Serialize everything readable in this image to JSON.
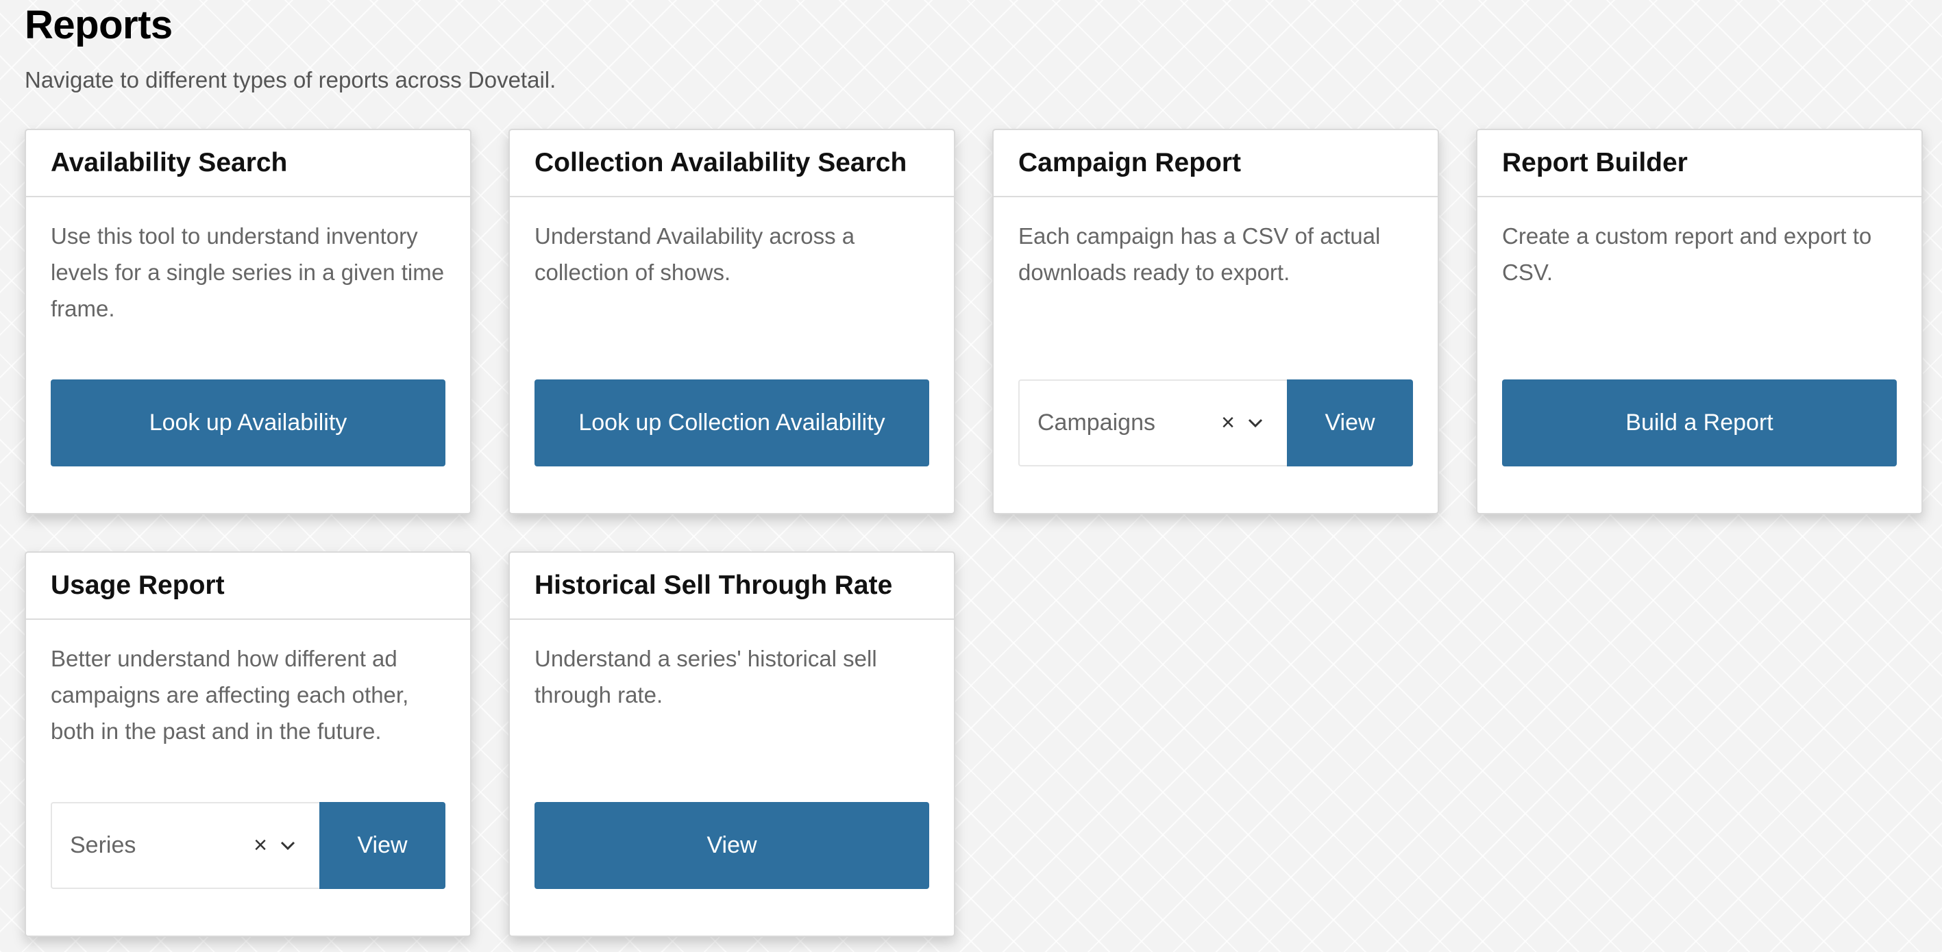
{
  "header": {
    "title": "Reports",
    "subtitle": "Navigate to different types of reports across Dovetail."
  },
  "cards": [
    {
      "title": "Availability Search",
      "description": "Use this tool to understand inventory levels for a single series in a given time frame.",
      "button_label": "Look up Availability"
    },
    {
      "title": "Collection Availability Search",
      "description": "Understand Availability across a collection of shows.",
      "button_label": "Look up Collection Availability"
    },
    {
      "title": "Campaign Report",
      "description": "Each campaign has a CSV of actual downloads ready to export.",
      "select_value": "Campaigns",
      "clear_icon": "×",
      "button_label": "View"
    },
    {
      "title": "Report Builder",
      "description": "Create a custom report and export to CSV.",
      "button_label": "Build a Report"
    },
    {
      "title": "Usage Report",
      "description": "Better understand how different ad campaigns are affecting each other, both in the past and in the future.",
      "select_value": "Series",
      "clear_icon": "×",
      "button_label": "View"
    },
    {
      "title": "Historical Sell Through Rate",
      "description": "Understand a series' historical sell through rate.",
      "button_label": "View"
    }
  ],
  "colors": {
    "accent": "#2e6f9e",
    "background": "#f3f3f3",
    "muted_text": "#666666"
  },
  "icons": {
    "clear": "close-icon",
    "dropdown": "chevron-down-icon"
  }
}
